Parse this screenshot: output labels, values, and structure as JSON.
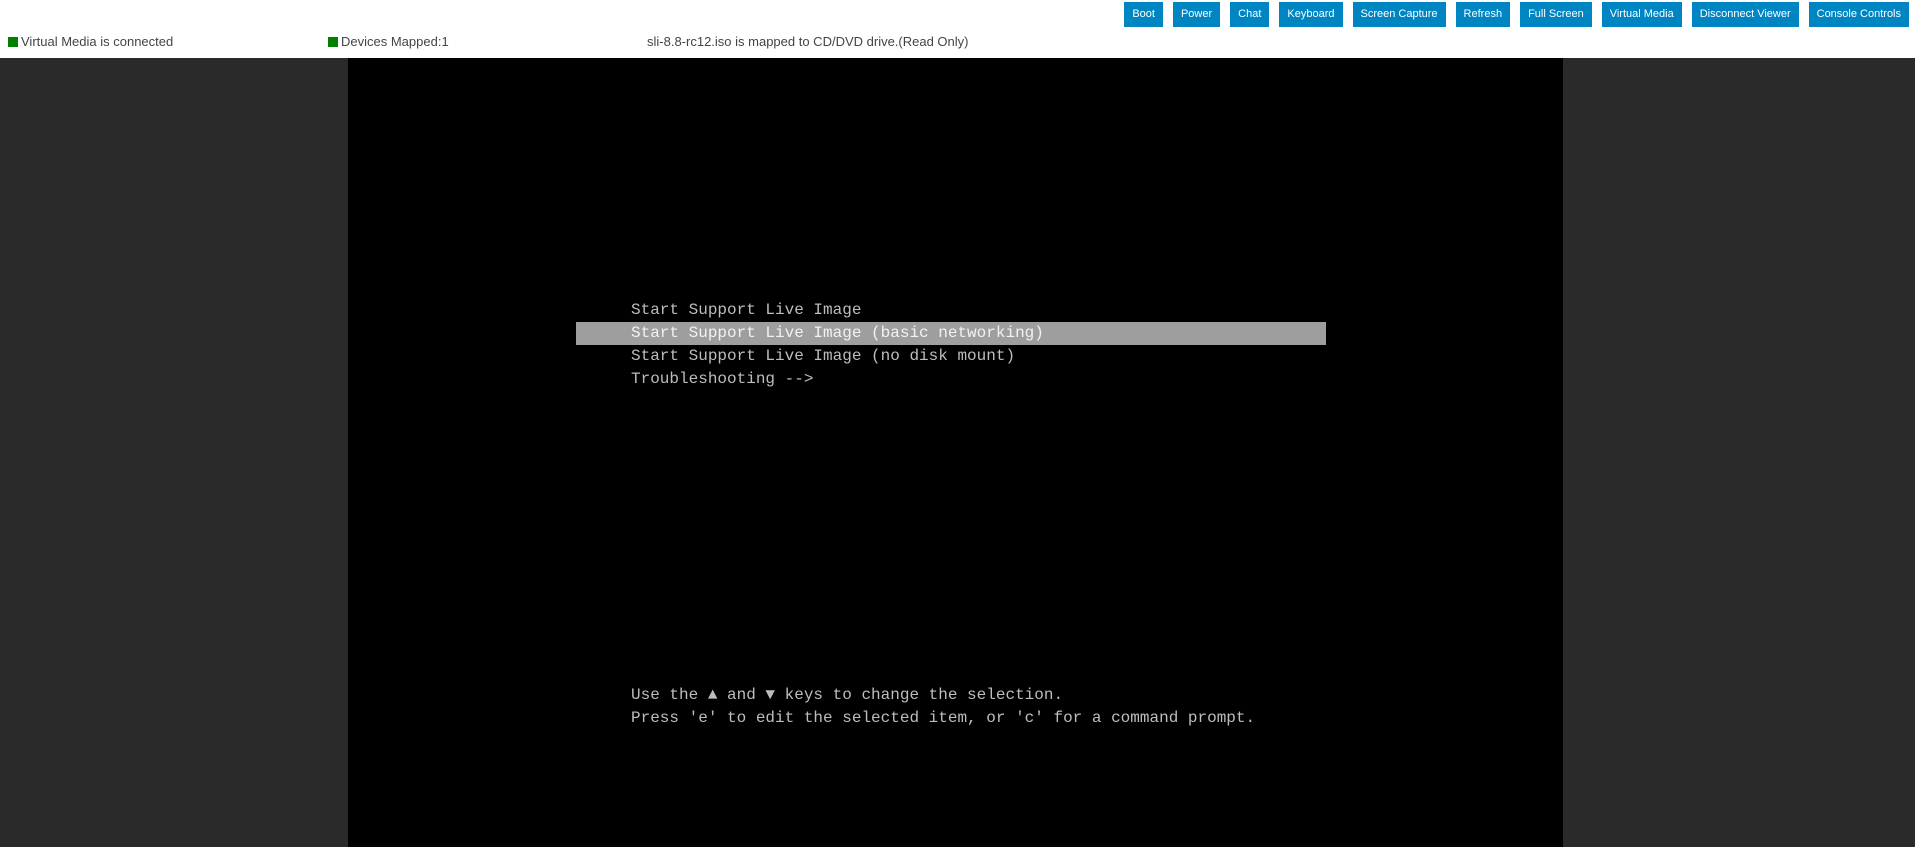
{
  "toolbar": {
    "buttons": [
      "Boot",
      "Power",
      "Chat",
      "Keyboard",
      "Screen Capture",
      "Refresh",
      "Full Screen",
      "Virtual Media",
      "Disconnect Viewer",
      "Console Controls"
    ]
  },
  "status": {
    "virtual_media": "Virtual Media is connected",
    "devices_mapped": "Devices Mapped:1",
    "mapping": "sli-8.8-rc12.iso is mapped to CD/DVD drive.(Read Only)",
    "indicator_color": "#008000"
  },
  "console": {
    "menu": [
      {
        "label": "Start Support Live Image",
        "selected": false
      },
      {
        "label": "Start Support Live Image (basic networking)",
        "selected": true
      },
      {
        "label": "Start Support Live Image (no disk mount)",
        "selected": false
      },
      {
        "label": "Troubleshooting -->",
        "selected": false
      }
    ],
    "help_line_1": "Use the ▲ and ▼ keys to change the selection.",
    "help_line_2": "Press 'e' to edit the selected item, or 'c' for a command prompt."
  },
  "colors": {
    "button": "#0085c3",
    "highlight": "#9e9e9e"
  }
}
